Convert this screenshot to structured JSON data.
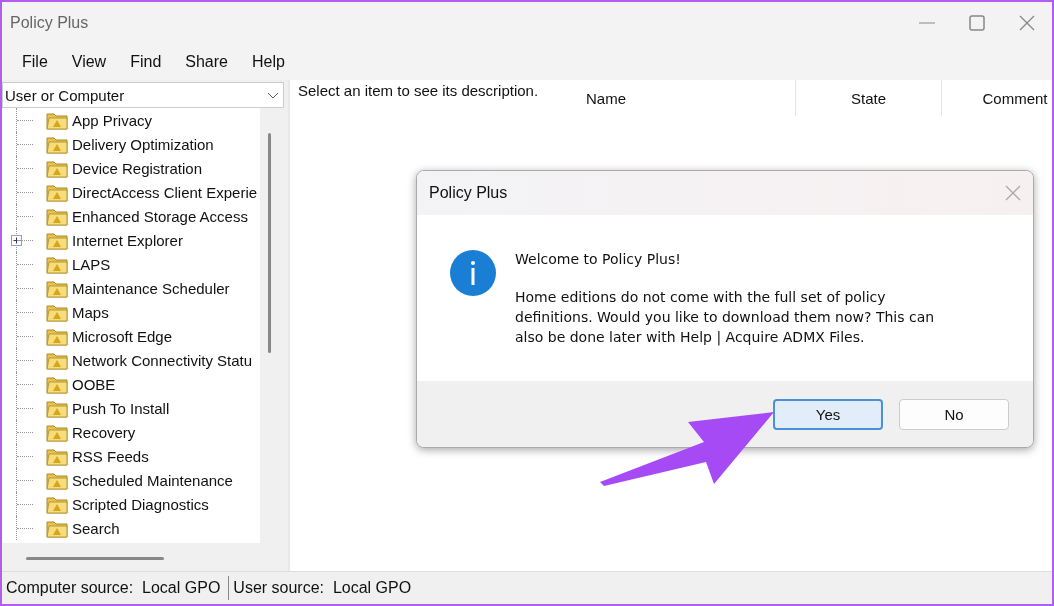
{
  "window": {
    "title": "Policy Plus"
  },
  "menu": [
    "File",
    "View",
    "Find",
    "Share",
    "Help"
  ],
  "scope_dropdown": {
    "value": "User or Computer"
  },
  "tree": {
    "items": [
      {
        "label": "App Privacy",
        "expandable": false
      },
      {
        "label": "Delivery Optimization",
        "expandable": false
      },
      {
        "label": "Device Registration",
        "expandable": false
      },
      {
        "label": "DirectAccess Client Experie",
        "expandable": false
      },
      {
        "label": "Enhanced Storage Access",
        "expandable": false
      },
      {
        "label": "Internet Explorer",
        "expandable": true
      },
      {
        "label": "LAPS",
        "expandable": false
      },
      {
        "label": "Maintenance Scheduler",
        "expandable": false
      },
      {
        "label": "Maps",
        "expandable": false
      },
      {
        "label": "Microsoft Edge",
        "expandable": false
      },
      {
        "label": "Network Connectivity Statu",
        "expandable": false
      },
      {
        "label": "OOBE",
        "expandable": false
      },
      {
        "label": "Push To Install",
        "expandable": false
      },
      {
        "label": "Recovery",
        "expandable": false
      },
      {
        "label": "RSS Feeds",
        "expandable": false
      },
      {
        "label": "Scheduled Maintenance",
        "expandable": false
      },
      {
        "label": "Scripted Diagnostics",
        "expandable": false
      },
      {
        "label": "Search",
        "expandable": false
      }
    ]
  },
  "description": "Select an item to see its description.",
  "table": {
    "columns": [
      "Name",
      "State",
      "Comment"
    ]
  },
  "dialog": {
    "title": "Policy Plus",
    "heading": "Welcome to Policy Plus!",
    "message": "Home editions do not come with the full set of policy definitions. Would you like to download them now? This can also be done later with Help | Acquire ADMX Files.",
    "buttons": [
      {
        "label": "Yes",
        "selected": true
      },
      {
        "label": "No",
        "selected": false
      }
    ]
  },
  "status_bar": [
    {
      "label": "Computer source:",
      "value": "Local GPO"
    },
    {
      "label": "User source:",
      "value": "Local GPO"
    }
  ]
}
